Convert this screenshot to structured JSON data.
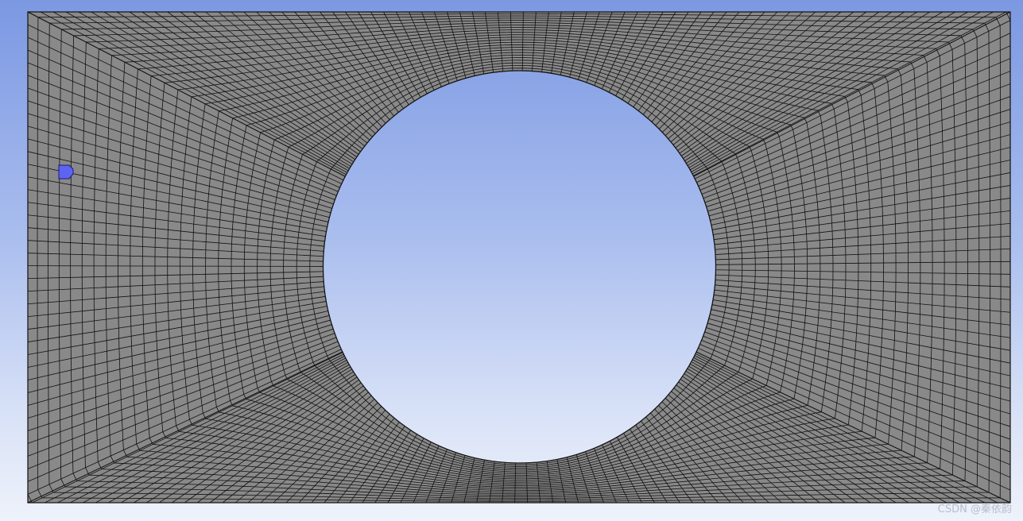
{
  "viewport": {
    "background_top": "#7b98e2",
    "background_bottom": "#eef2fb",
    "mesh_fill": "#898989",
    "mesh_line": "#111111",
    "mesh_type": "structured quadrilateral O-grid around circular hole",
    "marker_color": "#5c64f0",
    "marker_icon": "point-marker-icon"
  },
  "watermark": {
    "text": "CSDN @秦依韵"
  }
}
